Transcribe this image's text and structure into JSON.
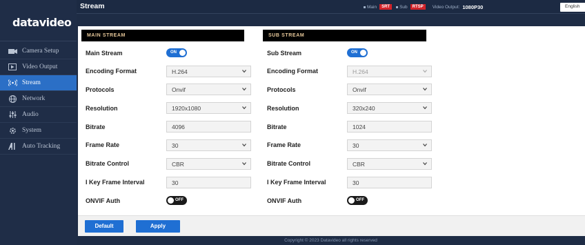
{
  "brand": {
    "logo": "datavideo"
  },
  "sidebar": {
    "items": [
      {
        "label": "Camera Setup",
        "icon": "camera-icon",
        "active": false
      },
      {
        "label": "Video Output",
        "icon": "video-output-icon",
        "active": false
      },
      {
        "label": "Stream",
        "icon": "stream-icon",
        "active": true
      },
      {
        "label": "Network",
        "icon": "network-icon",
        "active": false
      },
      {
        "label": "Audio",
        "icon": "audio-icon",
        "active": false
      },
      {
        "label": "System",
        "icon": "system-icon",
        "active": false
      },
      {
        "label": "Auto Tracking",
        "icon": "auto-tracking-icon",
        "active": false
      }
    ]
  },
  "header": {
    "title": "Stream",
    "status": {
      "main_label": "Main",
      "main_badge": "SRT",
      "sub_label": "Sub",
      "sub_badge": "RTSP",
      "video_output_label": "Video Output:",
      "video_output_value": "1080P30"
    },
    "language": "English"
  },
  "main_stream": {
    "section_title": "MAIN STREAM",
    "toggle_label": "Main Stream",
    "toggle_value": "ON",
    "encoding_label": "Encoding Format",
    "encoding_value": "H.264",
    "protocols_label": "Protocols",
    "protocols_value": "Onvif",
    "resolution_label": "Resolution",
    "resolution_value": "1920x1080",
    "bitrate_label": "Bitrate",
    "bitrate_value": "4096",
    "framerate_label": "Frame Rate",
    "framerate_value": "30",
    "bitrate_control_label": "Bitrate Control",
    "bitrate_control_value": "CBR",
    "keyframe_label": "I Key Frame Interval",
    "keyframe_value": "30",
    "onvif_label": "ONVIF Auth",
    "onvif_value": "OFF"
  },
  "sub_stream": {
    "section_title": "SUB STREAM",
    "toggle_label": "Sub Stream",
    "toggle_value": "ON",
    "encoding_label": "Encoding Format",
    "encoding_value": "H.264",
    "protocols_label": "Protocols",
    "protocols_value": "Onvif",
    "resolution_label": "Resolution",
    "resolution_value": "320x240",
    "bitrate_label": "Bitrate",
    "bitrate_value": "1024",
    "framerate_label": "Frame Rate",
    "framerate_value": "30",
    "bitrate_control_label": "Bitrate Control",
    "bitrate_control_value": "CBR",
    "keyframe_label": "I Key Frame Interval",
    "keyframe_value": "30",
    "onvif_label": "ONVIF Auth",
    "onvif_value": "OFF"
  },
  "actions": {
    "default_label": "Default",
    "apply_label": "Apply"
  },
  "footer": {
    "copyright": "Copyright © 2023 Datavideo all rights reserved"
  },
  "colors": {
    "accent": "#1f6fd3",
    "sidebar_bg": "#1f2d47",
    "active_nav": "#2b6fc6",
    "badge_red": "#d2232a",
    "section_title_text": "#e7c89a"
  }
}
